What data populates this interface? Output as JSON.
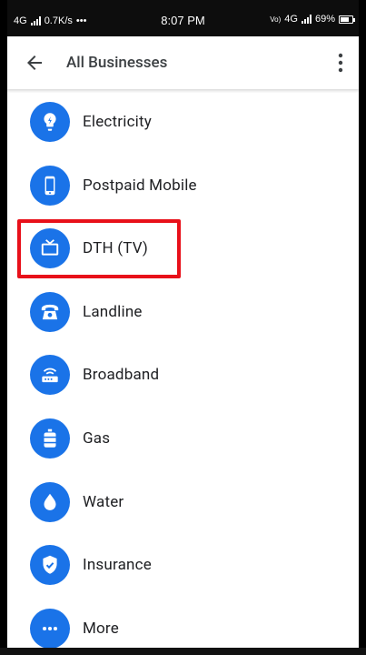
{
  "status_bar": {
    "network_left": "4G",
    "speed": "0.7K/s",
    "dots": "•••",
    "time": "8:07 PM",
    "volte": "Vo)",
    "network_right": "4G",
    "battery": "69%"
  },
  "header": {
    "title": "All Businesses",
    "back_icon": "arrow-back-icon",
    "menu_icon": "more-vert-icon"
  },
  "list": {
    "items": [
      {
        "label": "Electricity",
        "icon": "lightbulb-icon"
      },
      {
        "label": "Postpaid Mobile",
        "icon": "mobile-phone-icon"
      },
      {
        "label": "DTH (TV)",
        "icon": "tv-icon"
      },
      {
        "label": "Landline",
        "icon": "telephone-icon"
      },
      {
        "label": "Broadband",
        "icon": "router-icon"
      },
      {
        "label": "Gas",
        "icon": "gas-cylinder-icon"
      },
      {
        "label": "Water",
        "icon": "water-drop-icon"
      },
      {
        "label": "Insurance",
        "icon": "shield-check-icon"
      },
      {
        "label": "More",
        "icon": "more-horiz-icon"
      }
    ]
  },
  "colors": {
    "accent": "#1a73e8",
    "highlight": "#e8101a"
  }
}
